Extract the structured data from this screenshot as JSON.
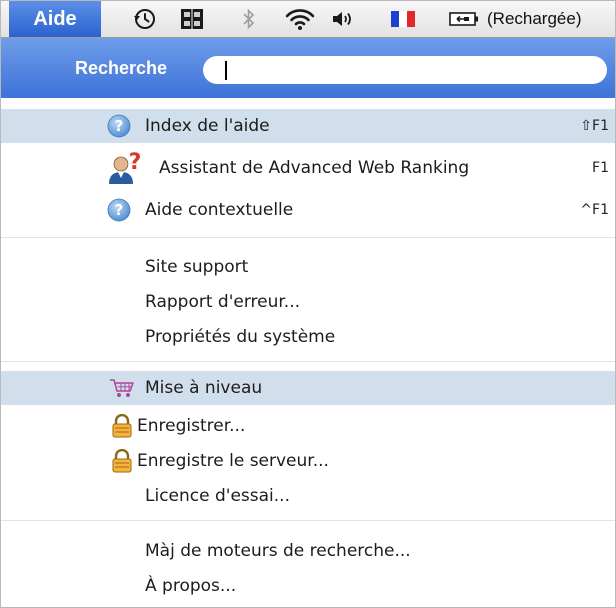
{
  "menubar": {
    "menu_title": "Aide",
    "battery_status": "(Rechargée)"
  },
  "search": {
    "label": "Recherche",
    "value": "",
    "placeholder": ""
  },
  "items": {
    "help_index": {
      "label": "Index de l'aide",
      "shortcut": "⇧F1"
    },
    "assistant": {
      "label": "Assistant de Advanced Web Ranking",
      "shortcut": "F1"
    },
    "context_help": {
      "label": "Aide contextuelle",
      "shortcut": "^F1"
    },
    "support_site": {
      "label": "Site support"
    },
    "error_report": {
      "label": "Rapport d'erreur..."
    },
    "system_props": {
      "label": "Propriétés du système"
    },
    "upgrade": {
      "label": "Mise à niveau"
    },
    "register": {
      "label": "Enregistrer..."
    },
    "register_server": {
      "label": "Enregistre le serveur..."
    },
    "trial_license": {
      "label": "Licence d'essai..."
    },
    "update_engines": {
      "label": "Màj de moteurs de recherche..."
    },
    "about": {
      "label": "À propos..."
    }
  },
  "colors": {
    "menu_title_bg": "#2c62cf",
    "search_bg": "#3d72d8",
    "highlight": "#d1dfec",
    "help_icon": "#5a95d6"
  },
  "icons": {
    "menubar": [
      "time-machine-icon",
      "app-grid-icon",
      "bluetooth-icon",
      "wifi-icon",
      "volume-icon",
      "french-flag-icon",
      "battery-icon"
    ],
    "help": "question-mark-icon",
    "assistant": "user-help-icon",
    "cart": "shopping-cart-icon",
    "lock": "padlock-icon"
  }
}
